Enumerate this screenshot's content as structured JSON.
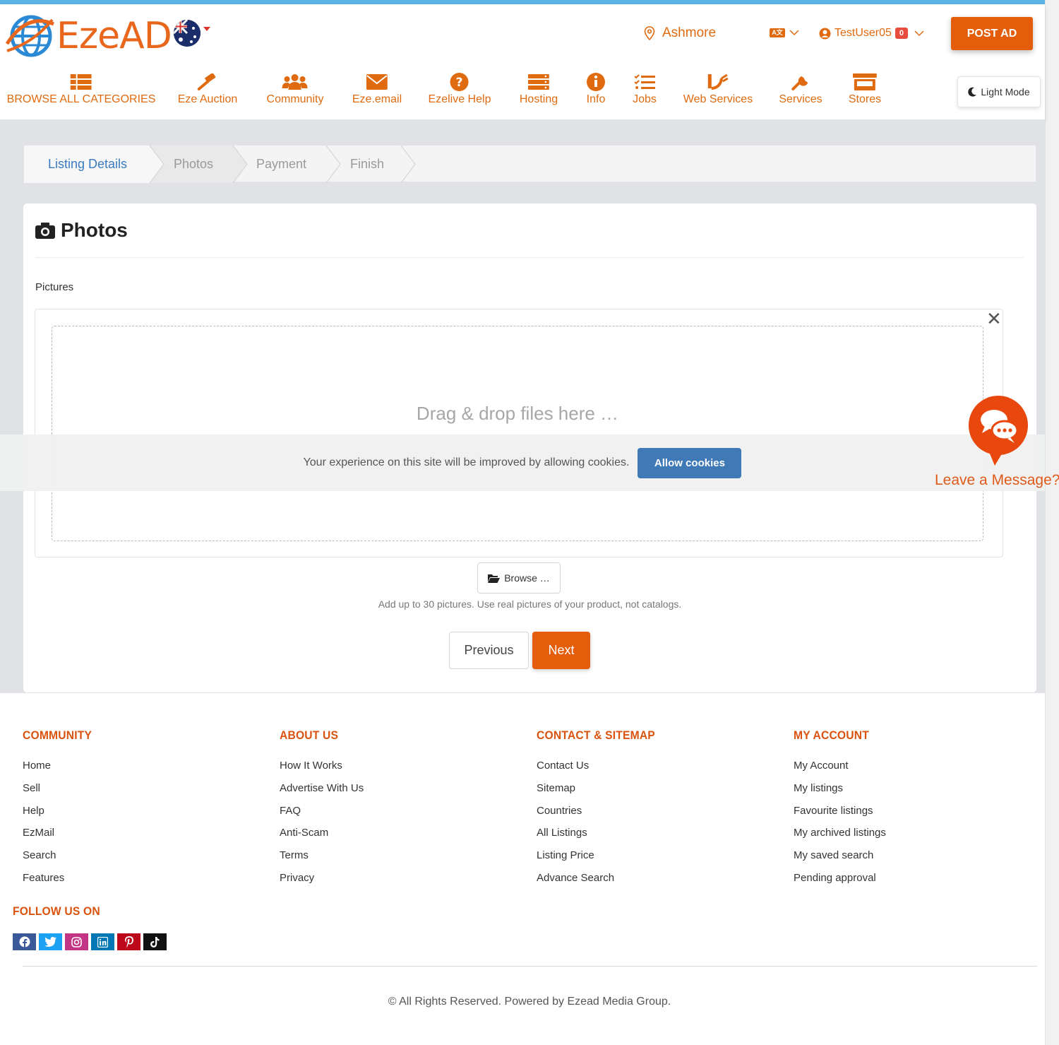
{
  "header": {
    "logo_text": "EzeAD",
    "location": "Ashmore",
    "username": "TestUser05",
    "notification_count": "0",
    "post_ad_label": "POST AD",
    "light_mode_label": "Light Mode"
  },
  "nav": [
    {
      "label": "BROWSE ALL CATEGORIES",
      "icon": "list-icon"
    },
    {
      "label": "Eze Auction",
      "icon": "gavel-icon"
    },
    {
      "label": "Community",
      "icon": "users-icon"
    },
    {
      "label": "Eze.email",
      "icon": "envelope-icon"
    },
    {
      "label": "Ezelive Help",
      "icon": "question-icon"
    },
    {
      "label": "Hosting",
      "icon": "server-icon"
    },
    {
      "label": "Info",
      "icon": "info-icon"
    },
    {
      "label": "Jobs",
      "icon": "tasks-icon"
    },
    {
      "label": "Web Services",
      "icon": "rss-icon"
    },
    {
      "label": "Services",
      "icon": "wrench-icon"
    },
    {
      "label": "Stores",
      "icon": "store-icon"
    }
  ],
  "steps": [
    "Listing Details",
    "Photos",
    "Payment",
    "Finish"
  ],
  "card": {
    "title": "Photos",
    "pictures_label": "Pictures",
    "drop_text": "Drag & drop files here …",
    "browse_label": "Browse …",
    "hint": "Add up to 30 pictures. Use real pictures of your product, not catalogs.",
    "previous_label": "Previous",
    "next_label": "Next"
  },
  "cookie": {
    "text": "Your experience on this site will be improved by allowing cookies.",
    "button": "Allow cookies"
  },
  "chat": {
    "label": "Leave a Message?"
  },
  "footer": {
    "columns": [
      {
        "heading": "COMMUNITY",
        "links": [
          "Home",
          "Sell",
          "Help",
          "EzMail",
          "Search",
          "Features"
        ]
      },
      {
        "heading": "ABOUT US",
        "links": [
          "How It Works",
          "Advertise With Us",
          "FAQ",
          "Anti-Scam",
          "Terms",
          "Privacy"
        ]
      },
      {
        "heading": "CONTACT & SITEMAP",
        "links": [
          "Contact Us",
          "Sitemap",
          "Countries",
          "All Listings",
          "Listing Price",
          "Advance Search"
        ]
      },
      {
        "heading": "MY ACCOUNT",
        "links": [
          "My Account",
          "My listings",
          "Favourite listings",
          "My archived listings",
          "My saved search",
          "Pending approval"
        ]
      }
    ],
    "follow_heading": "FOLLOW US ON",
    "socials": [
      {
        "name": "facebook-icon",
        "color": "#3b5998"
      },
      {
        "name": "twitter-icon",
        "color": "#1da1f2"
      },
      {
        "name": "instagram-icon",
        "color": "#c13584"
      },
      {
        "name": "linkedin-icon",
        "color": "#0077b5"
      },
      {
        "name": "pinterest-icon",
        "color": "#bd081c"
      },
      {
        "name": "tiktok-icon",
        "color": "#111111"
      }
    ],
    "copyright": "© All Rights Reserved. Powered by Ezead Media Group."
  },
  "colors": {
    "brand_orange": "#e35d0a",
    "step_active": "#3a7bbf",
    "cookie_button": "#3f7ab6"
  }
}
